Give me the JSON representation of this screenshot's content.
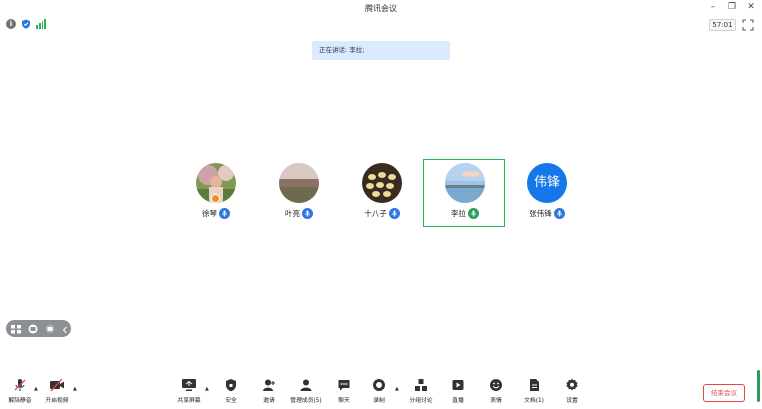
{
  "window": {
    "title": "腾讯会议",
    "controls": {
      "minimize": "–",
      "restore": "❐",
      "close": "✕"
    }
  },
  "status": {
    "timer": "57:01",
    "icons": [
      "info-icon",
      "security-shield-icon",
      "signal-icon"
    ]
  },
  "speaking_banner": {
    "label": "正在讲话: 李拉;"
  },
  "participants": [
    {
      "name": "徐琴",
      "avatar": "photo-person-flowers",
      "mic": "muted",
      "host": true,
      "active": false
    },
    {
      "name": "叶亮",
      "avatar": "photo-field-landscape",
      "mic": "muted",
      "host": false,
      "active": false
    },
    {
      "name": "十八子",
      "avatar": "photo-dumplings",
      "mic": "muted",
      "host": false,
      "active": false
    },
    {
      "name": "李拉",
      "avatar": "photo-pier-sky",
      "mic": "speaking",
      "host": false,
      "active": true
    },
    {
      "name": "张伟锋",
      "avatar_text": "伟锋",
      "mic": "muted",
      "host": false,
      "active": false
    }
  ],
  "toolbar": {
    "items": [
      {
        "label": "解除静音",
        "icon": "mic-off-icon"
      },
      {
        "label": "开启视频",
        "icon": "camera-off-icon"
      },
      {
        "label": "共享屏幕",
        "icon": "share-screen-icon"
      },
      {
        "label": "安全",
        "icon": "shield-icon"
      },
      {
        "label": "邀请",
        "icon": "invite-icon"
      },
      {
        "label": "管理成员(5)",
        "icon": "members-icon"
      },
      {
        "label": "聊天",
        "icon": "chat-icon"
      },
      {
        "label": "录制",
        "icon": "record-icon"
      },
      {
        "label": "分组讨论",
        "icon": "breakout-icon"
      },
      {
        "label": "直播",
        "icon": "live-icon"
      },
      {
        "label": "表情",
        "icon": "emoji-icon"
      },
      {
        "label": "文档(1)",
        "icon": "document-icon"
      },
      {
        "label": "设置",
        "icon": "settings-icon"
      }
    ],
    "end_meeting": "结束会议"
  },
  "colors": {
    "accent_blue": "#1677ea",
    "active_border": "#20b856",
    "end_red": "#e44747",
    "banner_bg": "#dbeafd"
  }
}
